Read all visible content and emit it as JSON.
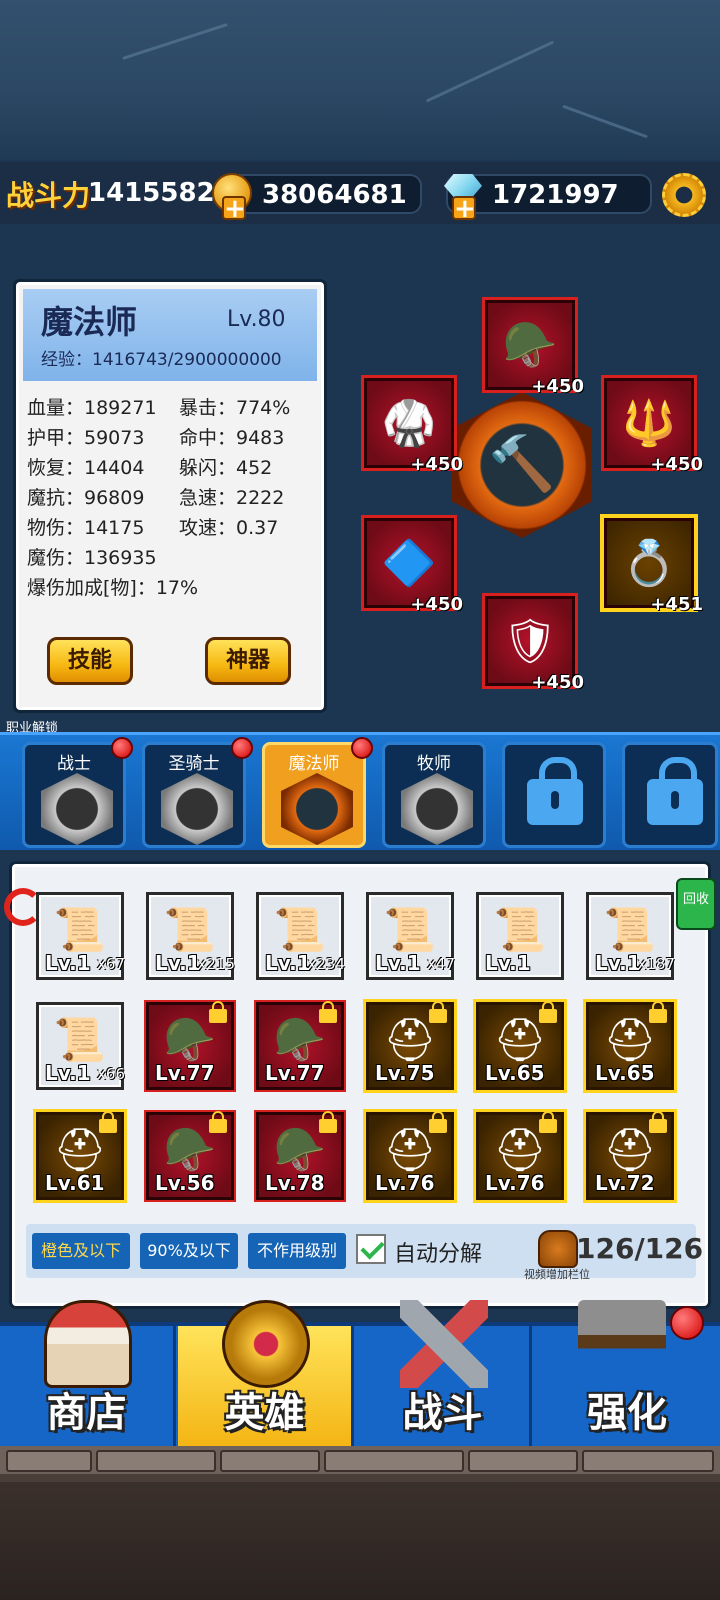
{
  "resources": {
    "power_label": "战斗力",
    "power_value": "14155820",
    "gold_value": "38064681",
    "diamond_value": "1721997",
    "icons": [
      "gold-coin-icon",
      "diamond-icon",
      "gear-icon"
    ]
  },
  "hero": {
    "name": "魔法师",
    "level": "Lv.80",
    "exp": "经验：1416743/2900000000",
    "stats": [
      "血量：189271",
      "暴击：774%",
      "护甲：59073",
      "命中：9483",
      "恢复：14404",
      "躲闪：452",
      "魔抗：96809",
      "急速：2222",
      "物伤：14175",
      "攻速：0.37",
      "魔伤：136935",
      "爆伤加成[物]：17%"
    ],
    "skill_btn": "技能",
    "artifact_btn": "神器"
  },
  "equipment": [
    {
      "slot": "top",
      "plus": "+450"
    },
    {
      "slot": "upper-left",
      "plus": "+450"
    },
    {
      "slot": "upper-right",
      "plus": "+450"
    },
    {
      "slot": "lower-left",
      "plus": "+450"
    },
    {
      "slot": "lower-right",
      "plus": "+451"
    },
    {
      "slot": "bottom",
      "plus": "+450"
    }
  ],
  "class_bar": {
    "title": "职业解锁",
    "classes": [
      {
        "name": "战士",
        "dot": true,
        "active": false
      },
      {
        "name": "圣骑士",
        "dot": true,
        "active": false
      },
      {
        "name": "魔法师",
        "dot": true,
        "active": true
      },
      {
        "name": "牧师",
        "dot": false,
        "active": false
      }
    ],
    "locked_count": 2
  },
  "inventory": {
    "recycle_label": "回收",
    "items": [
      {
        "lv": "Lv.1",
        "count": "x67",
        "tier": "white",
        "locked": false
      },
      {
        "lv": "Lv.1",
        "count": "x215",
        "tier": "white",
        "locked": false
      },
      {
        "lv": "Lv.1",
        "count": "x234",
        "tier": "white",
        "locked": false
      },
      {
        "lv": "Lv.1",
        "count": "x47",
        "tier": "white",
        "locked": false
      },
      {
        "lv": "Lv.1",
        "count": "",
        "tier": "white",
        "locked": false
      },
      {
        "lv": "Lv.1",
        "count": "x187",
        "tier": "white",
        "locked": false
      },
      {
        "lv": "Lv.1",
        "count": "x66",
        "tier": "white",
        "locked": false
      },
      {
        "lv": "Lv.77",
        "count": "",
        "tier": "red",
        "locked": true
      },
      {
        "lv": "Lv.77",
        "count": "",
        "tier": "red",
        "locked": true
      },
      {
        "lv": "Lv.75",
        "count": "",
        "tier": "gold",
        "locked": true
      },
      {
        "lv": "Lv.65",
        "count": "",
        "tier": "gold",
        "locked": true
      },
      {
        "lv": "Lv.65",
        "count": "",
        "tier": "gold",
        "locked": true
      },
      {
        "lv": "Lv.61",
        "count": "",
        "tier": "gold",
        "locked": true
      },
      {
        "lv": "Lv.56",
        "count": "",
        "tier": "red",
        "locked": true
      },
      {
        "lv": "Lv.78",
        "count": "",
        "tier": "red",
        "locked": true
      },
      {
        "lv": "Lv.76",
        "count": "",
        "tier": "gold",
        "locked": true
      },
      {
        "lv": "Lv.76",
        "count": "",
        "tier": "gold",
        "locked": true
      },
      {
        "lv": "Lv.72",
        "count": "",
        "tier": "gold",
        "locked": true
      }
    ],
    "filters": [
      "橙色及以下",
      "90%及以下",
      "不作用级别"
    ],
    "auto_decompose": "自动分解",
    "slot_count": "126/126",
    "slot_hint": "视频增加栏位"
  },
  "nav": [
    "商店",
    "英雄",
    "战斗",
    "强化"
  ],
  "colors": {
    "accent": "#ffd23b",
    "nav_blue": "#1666c7",
    "active_yellow": "#f4b514"
  }
}
